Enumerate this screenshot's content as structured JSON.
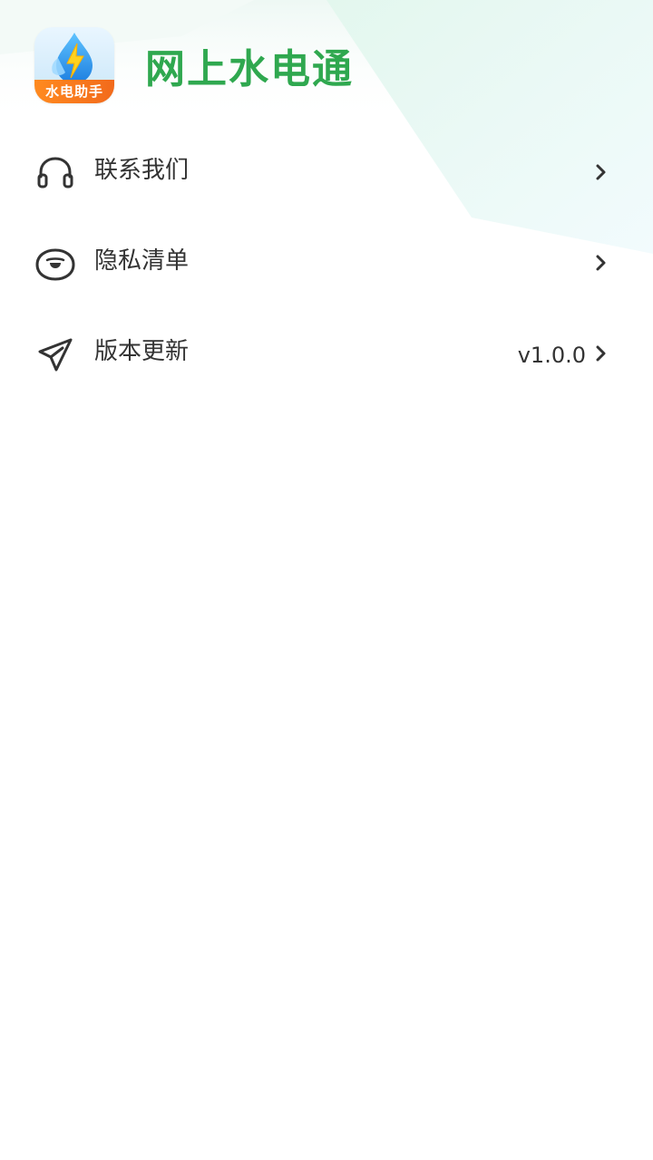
{
  "app": {
    "title": "网上水电通",
    "icon_badge": "水电助手"
  },
  "menu": {
    "items": [
      {
        "label": "联系我们",
        "icon": "headset-icon"
      },
      {
        "label": "隐私清单",
        "icon": "face-icon"
      },
      {
        "label": "版本更新",
        "icon": "send-icon",
        "value": "v1.0.0"
      }
    ]
  },
  "colors": {
    "title": "#2fa84f",
    "text": "#333333",
    "badge": "#f26a1b",
    "background_tint": "#e6f8f2"
  }
}
